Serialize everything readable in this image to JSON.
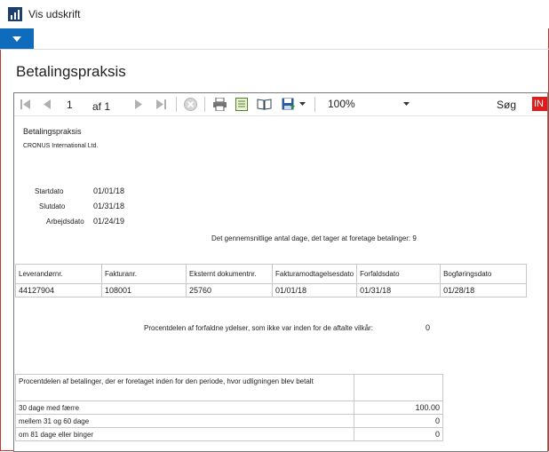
{
  "app": {
    "title": "Vis udskrift"
  },
  "page": {
    "title": "Betalingspraksis"
  },
  "toolbar": {
    "current_page": "1",
    "page_of": "af 1",
    "zoom": "100%",
    "search_label": "Søg",
    "badge": "IN"
  },
  "report": {
    "title": "Betalingspraksis",
    "company": "CRONUS International Ltd.",
    "dates": [
      {
        "label": "Startdato",
        "value": "01/01/18"
      },
      {
        "label": "Slutdato",
        "value": "01/31/18"
      },
      {
        "label": "Arbejdsdato",
        "value": "01/24/19"
      }
    ],
    "avg_days_text": "Det gennemsnitlige antal dage, det tager at foretage betalinger: 9",
    "columns": [
      "Leverandørnr.",
      "Fakturanr.",
      "Eksternt dokumentnr.",
      "Fakturamodtagelsesdato",
      "Forfaldsdato",
      "Bogføringsdato"
    ],
    "row": [
      "44127904",
      "108001",
      "25760",
      "01/01/18",
      "01/31/18",
      "01/28/18"
    ],
    "overdue_label": "Procentdelen af forfaldne ydelser, som ikke var inden for de aftalte vilkår:",
    "overdue_value": "0",
    "payments_header": "Procentdelen af betalinger, der er foretaget inden for den periode, hvor udligningen blev betalt",
    "payment_rows": [
      {
        "label": "30 dage med færre",
        "value": "100.00"
      },
      {
        "label": "mellem 31 og 60 dage",
        "value": "0"
      },
      {
        "label": "om 81 dage eller binger",
        "value": "0"
      }
    ]
  }
}
